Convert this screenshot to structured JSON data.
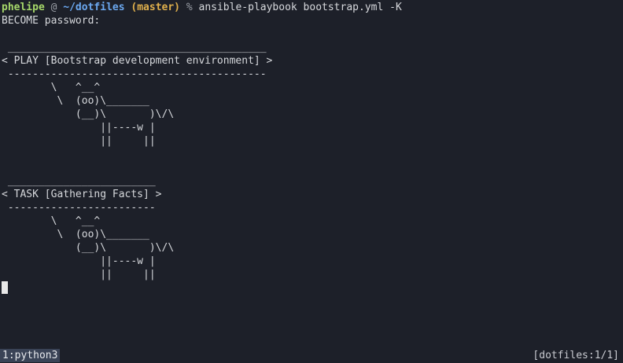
{
  "prompt": {
    "user": "phelipe",
    "at": "@",
    "path": "~/dotfiles",
    "branch": "(master)",
    "symbol": "%",
    "command": "ansible-playbook bootstrap.yml -K"
  },
  "output_lines": [
    "BECOME password:",
    "",
    " __________________________________________",
    "< PLAY [Bootstrap development environment] >",
    " ------------------------------------------",
    "        \\   ^__^",
    "         \\  (oo)\\_______",
    "            (__)\\       )\\/\\",
    "                ||----w |",
    "                ||     ||",
    "",
    "",
    " ________________________",
    "< TASK [Gathering Facts] >",
    " ------------------------",
    "        \\   ^__^",
    "         \\  (oo)\\_______",
    "            (__)\\       )\\/\\",
    "                ||----w |",
    "                ||     ||",
    ""
  ],
  "statusbar": {
    "window_label": "1:python3",
    "session_label": "[dotfiles:1/1]"
  },
  "colors": {
    "background": "#1d2029",
    "foreground": "#d6d8dc",
    "user": "#a6d86a",
    "path": "#6ba8f0",
    "branch": "#e0b04c",
    "status_tab_bg": "#3a4356"
  }
}
